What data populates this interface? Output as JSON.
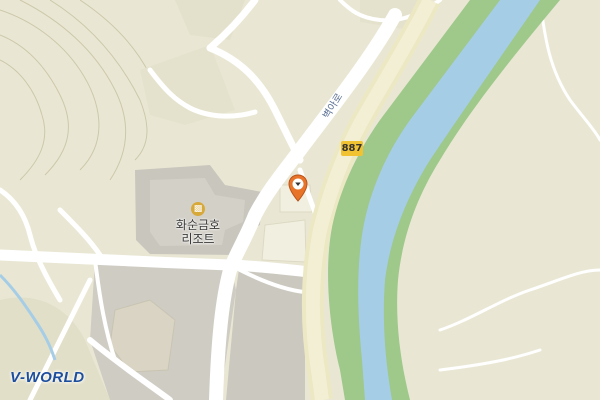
{
  "map": {
    "road_number": "887",
    "road_name": "벽아로",
    "poi": {
      "icon": "resort-icon",
      "label_line1": "화순금호",
      "label_line2": "리조트"
    },
    "marker_icon": "location-pin-icon",
    "logo_text": "V-WORLD",
    "colors": {
      "land": "#e9e7d3",
      "road": "#ffffff",
      "water": "#a6cde6",
      "river_bank": "#9fc88b",
      "building": "#cfccc4",
      "marker": "#e8742a",
      "highway": "#f1c232"
    }
  }
}
